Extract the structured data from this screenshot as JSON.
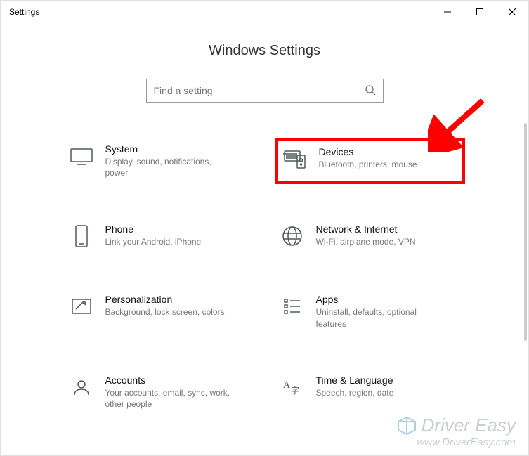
{
  "window": {
    "title": "Settings"
  },
  "page": {
    "heading": "Windows Settings"
  },
  "search": {
    "placeholder": "Find a setting"
  },
  "tiles": {
    "system": {
      "title": "System",
      "sub": "Display, sound, notifications, power"
    },
    "devices": {
      "title": "Devices",
      "sub": "Bluetooth, printers, mouse"
    },
    "phone": {
      "title": "Phone",
      "sub": "Link your Android, iPhone"
    },
    "network": {
      "title": "Network & Internet",
      "sub": "Wi-Fi, airplane mode, VPN"
    },
    "personalization": {
      "title": "Personalization",
      "sub": "Background, lock screen, colors"
    },
    "apps": {
      "title": "Apps",
      "sub": "Uninstall, defaults, optional features"
    },
    "accounts": {
      "title": "Accounts",
      "sub": "Your accounts, email, sync, work, other people"
    },
    "time": {
      "title": "Time & Language",
      "sub": "Speech, region, date"
    }
  },
  "watermark": {
    "brand": "Driver Easy",
    "url": "www.DriverEasy.com"
  }
}
